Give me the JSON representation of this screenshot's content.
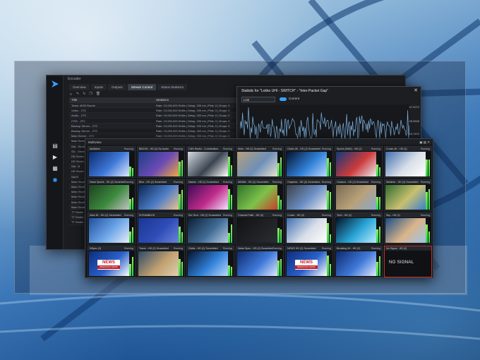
{
  "app": {
    "header": "Encoder",
    "tabs": [
      "Overview",
      "Inputs",
      "Outputs",
      "Stream Control",
      "Status Statistics"
    ],
    "active_tab": 3,
    "table": {
      "columns": [
        "Title",
        "Statistics"
      ],
      "rows": [
        {
          "title": "Tower 4K50 Bunde",
          "stat": "Rate: 19,000,000 Kbit/s | Delay: 200 ms | Pkts: 0 | Drops: 0"
        },
        {
          "title": "Video - 2TC",
          "stat": "Rate: 19,000,000 Kbit/s | Delay: 200 ms | Pkts: 0 | Drops: 0"
        },
        {
          "title": "Audio - 2TC",
          "stat": "Rate: 19,000,000 Kbit/s | Delay: 200 ms | Pkts: 0 | Drops: 0"
        },
        {
          "title": "ITSS - 2TC",
          "stat": "Rate: 19,000,000 Kbit/s | Delay: 200 ms | Pkts: 0 | Drops: 0"
        },
        {
          "title": "Backup Server - 2TC",
          "stat": "Rate: 19,000,000 Kbit/s | Delay: 200 ms | Pkts: 0 | Drops: 0"
        },
        {
          "title": "Backup Server - 2TC",
          "stat": "Rate: 19,000,000 Kbit/s | Delay: 200 ms | Pkts: 0 | Drops: 0"
        },
        {
          "title": "Main Server - 2TC",
          "stat": "Rate: 19,000,000 Kbit/s | Delay: 200 ms | Pkts: 0 | Drops: 0"
        },
        {
          "title": "Main Server - 2TC",
          "stat": "Rate: 19,000,000 Kbit/s | Delay: 200 ms | Pkts: 0 | Drops: 0"
        },
        {
          "title": "Sat - Studio - 2TC",
          "stat": "Rate: 19,000,000 Kbit/s | Delay: 200 ms | Pkts: 0 | Drops: 0"
        },
        {
          "title": "SD - Studio",
          "stat": "Rate: 19,000,000 Kbit/s | Delay: 200 ms | Pkts: 0 | Drops: 0"
        },
        {
          "title": "HD Studio",
          "stat": ""
        },
        {
          "title": "HD Studio",
          "stat": ""
        },
        {
          "title": "Sat - B",
          "stat": ""
        },
        {
          "title": "HD Studio",
          "stat": ""
        },
        {
          "title": "Sat B",
          "stat": ""
        },
        {
          "title": "Main Studio",
          "stat": ""
        },
        {
          "title": "Main Studio",
          "stat": ""
        },
        {
          "title": "Main Studio",
          "stat": ""
        },
        {
          "title": "Main Studio",
          "stat": ""
        },
        {
          "title": "Main Studio",
          "stat": ""
        },
        {
          "title": "Main Studio",
          "stat": ""
        },
        {
          "title": "TT Studio",
          "stat": ""
        },
        {
          "title": "TT Studio",
          "stat": ""
        },
        {
          "title": "TT Studio",
          "stat": ""
        }
      ]
    }
  },
  "stats": {
    "title": "Statistic for \"Lokko UHI - SWITCH\" - \"Inter-Packet Gap\"",
    "select_value": "Link",
    "toggle_label": "Current",
    "close_glyph": "✕",
    "axis_labels": [
      "47.0272",
      "28.3545",
      "16.7670"
    ],
    "accent": "#3aa0ff",
    "line_color": "#7fb2e0"
  },
  "multiviewer": {
    "title": "Multiview",
    "header_right": "▣ ▤ ✕",
    "tiles": [
      {
        "label": "Multiview",
        "badge": "Running",
        "video": "news-studio"
      },
      {
        "label": "BBCHD - HD (2) No Audio",
        "badge": "Running",
        "video": "weather"
      },
      {
        "label": "CNN Studio - Combination",
        "badge": "Running",
        "video": "studio-desk"
      },
      {
        "label": "Mobi - HD (3) Scrambled",
        "badge": "Running",
        "video": "outdoor-sign"
      },
      {
        "label": "Globe 4K - HD (2) Scrambled",
        "badge": "Running",
        "video": "globe"
      },
      {
        "label": "Sports (MAD) - HD (2)",
        "badge": "Running",
        "video": "studio-host"
      },
      {
        "label": "Cruise 4K - HD (2)",
        "badge": "Running",
        "video": "ship"
      },
      {
        "label": "News Sports - HD (2) Scrambled",
        "badge": "Running",
        "video": "stadium"
      },
      {
        "label": "Blue - HD (2) Scrambled",
        "badge": "Running",
        "video": "people"
      },
      {
        "label": "Nature - HD (2) Scrambled",
        "badge": "Running",
        "video": "concert"
      },
      {
        "label": "Wildlife - HD (2) Scrambled",
        "badge": "Running",
        "video": "insect"
      },
      {
        "label": "Graphics - HD (2) Scrambled",
        "badge": "Running",
        "video": "screen-ui"
      },
      {
        "label": "Outdoor - HD (2) Scrambled",
        "badge": "Running",
        "video": "street"
      },
      {
        "label": "Weather - HD (2) Scrambled",
        "badge": "Running",
        "video": "weather-map"
      },
      {
        "label": "Intra 4K - HD (2) Scrambled",
        "badge": "Running",
        "video": "host-blue"
      },
      {
        "label": "SCRAMBLED",
        "badge": "Running",
        "video": "scrambled"
      },
      {
        "label": "Sci-Tech - HD (2) Scrambled",
        "badge": "Running",
        "video": "tunnel"
      },
      {
        "label": "Channel Faith - HD (2)",
        "badge": "Running",
        "video": "dark"
      },
      {
        "label": "Cruise - HD (2)",
        "badge": "Running",
        "video": "ship"
      },
      {
        "label": "Tech - HD (2)",
        "badge": "Running",
        "video": "particles"
      },
      {
        "label": "Sky - HD (2)",
        "badge": "Running",
        "video": "portrait"
      },
      {
        "label": "NSpec (2)",
        "badge": "Running",
        "video": "news-logo"
      },
      {
        "label": "Travel - HD (2) Scrambled",
        "badge": "Running",
        "video": "city"
      },
      {
        "label": "Globe - HD (2) Scrambled",
        "badge": "Running",
        "video": "globe"
      },
      {
        "label": "News Spec - HD (2) Scrambled",
        "badge": "Running",
        "video": "news-studio"
      },
      {
        "label": "NEWS HD (2) Scrambled",
        "badge": "Running",
        "video": "news-logo"
      },
      {
        "label": "Breaking 4K - HD (2)",
        "badge": "Running",
        "video": "news-studio"
      },
      {
        "label": "No Signal - HD (2)",
        "badge": "",
        "video": "no-signal"
      }
    ],
    "news_text": "NEWS",
    "news_sub": "BREAKING NEWS",
    "no_signal_text": "NO SIGNAL"
  }
}
